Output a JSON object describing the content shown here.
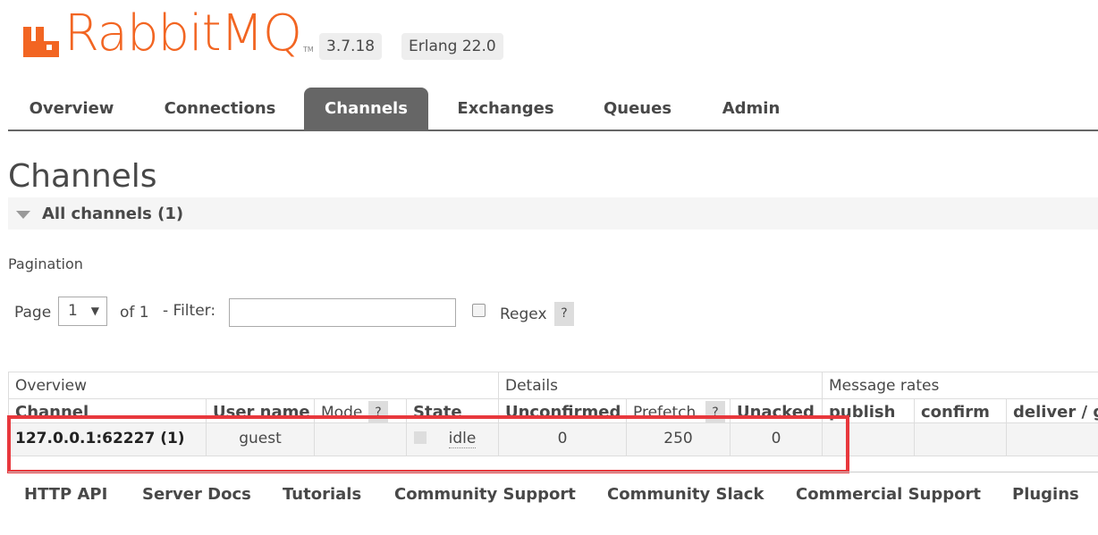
{
  "header": {
    "logo_text": "RabbitMQ",
    "logo_tm": "TM",
    "version": "3.7.18",
    "erlang": "Erlang 22.0",
    "brand_color": "#f26522"
  },
  "tabs": [
    {
      "label": "Overview"
    },
    {
      "label": "Connections"
    },
    {
      "label": "Channels",
      "active": true
    },
    {
      "label": "Exchanges"
    },
    {
      "label": "Queues"
    },
    {
      "label": "Admin"
    }
  ],
  "page": {
    "title": "Channels",
    "section": "All channels (1)"
  },
  "pagination": {
    "label": "Pagination",
    "page_label": "Page",
    "page_value": "1",
    "of_label": "of 1",
    "filter_label": "- Filter:",
    "filter_value": "",
    "regex_label": "Regex",
    "help": "?"
  },
  "table": {
    "groups": [
      "Overview",
      "Details",
      "Message rates"
    ],
    "columns": [
      "Channel",
      "User name",
      "Mode",
      "State",
      "Unconfirmed",
      "Prefetch",
      "Unacked",
      "publish",
      "confirm",
      "deliver / g"
    ],
    "help": "?",
    "row": {
      "channel": "127.0.0.1:62227 (1)",
      "user": "guest",
      "mode": "",
      "state": "idle",
      "unconfirmed": "0",
      "prefetch": "250",
      "unacked": "0"
    }
  },
  "footer": [
    "HTTP API",
    "Server Docs",
    "Tutorials",
    "Community Support",
    "Community Slack",
    "Commercial Support",
    "Plugins"
  ],
  "colors": {
    "highlight": "#e8383d",
    "active_tab": "#666666"
  }
}
